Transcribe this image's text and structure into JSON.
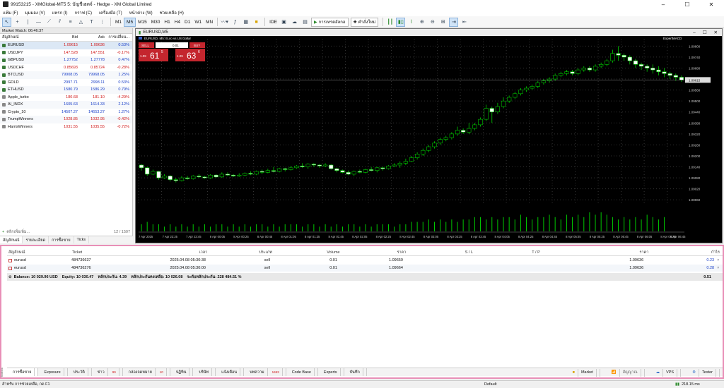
{
  "window": {
    "title": "99153215 - XMGlobal-MT5 5: บัญชีเฮดจ์ - Hedge - XM Global Limited"
  },
  "menu": [
    "แฟ้ม (F)",
    "มุมมอง (V)",
    "แทรก (I)",
    "กราฟ (C)",
    "เครื่องมือ (T)",
    "หน้าต่าง (W)",
    "ช่วยเหลือ (H)"
  ],
  "toolbar": {
    "timeframes": [
      "M1",
      "M5",
      "M15",
      "M30",
      "H1",
      "H4",
      "D1",
      "W1",
      "MN"
    ],
    "active_timeframe": "M5",
    "ide_label": "IDE",
    "algo_label": "การเทรดอัลกอ",
    "new_order_label": "คำสั่งใหม่"
  },
  "market_watch": {
    "header": "Market Watch: 06:46:37",
    "columns": {
      "symbol": "สัญลักษณ์",
      "bid": "Bid",
      "ask": "Ask",
      "change": "การเปลี่ยน..."
    },
    "rows": [
      {
        "symbol": "EURUSD",
        "bid": "1.09615",
        "ask": "1.09636",
        "change": "0.53%",
        "bid_color": "red",
        "ask_color": "red",
        "chg_color": "blue"
      },
      {
        "symbol": "USDJPY",
        "bid": "147.528",
        "ask": "147.551",
        "change": "-0.17%",
        "bid_color": "red",
        "ask_color": "red",
        "chg_color": "red"
      },
      {
        "symbol": "GBPUSD",
        "bid": "1.27752",
        "ask": "1.27778",
        "change": "0.47%",
        "bid_color": "blue",
        "ask_color": "blue",
        "chg_color": "blue"
      },
      {
        "symbol": "USDCHF",
        "bid": "0.85693",
        "ask": "0.85724",
        "change": "-0.28%",
        "bid_color": "red",
        "ask_color": "red",
        "chg_color": "red"
      },
      {
        "symbol": "BTCUSD",
        "bid": "79908.05",
        "ask": "79968.05",
        "change": "1.25%",
        "bid_color": "blue",
        "ask_color": "blue",
        "chg_color": "blue"
      },
      {
        "symbol": "GOLD",
        "bid": "2997.71",
        "ask": "2998.11",
        "change": "0.53%",
        "bid_color": "blue",
        "ask_color": "blue",
        "chg_color": "blue"
      },
      {
        "symbol": "ETHUSD",
        "bid": "1580.79",
        "ask": "1586.29",
        "change": "0.79%",
        "bid_color": "blue",
        "ask_color": "blue",
        "chg_color": "blue"
      },
      {
        "symbol": "Apple_turbo",
        "bid": "180.68",
        "ask": "181.10",
        "change": "-4.29%",
        "bid_color": "red",
        "ask_color": "red",
        "chg_color": "red"
      },
      {
        "symbol": "AI_INDX",
        "bid": "1605.63",
        "ask": "1614.33",
        "change": "2.12%",
        "bid_color": "blue",
        "ask_color": "blue",
        "chg_color": "blue"
      },
      {
        "symbol": "Crypto_10",
        "bid": "14507.27",
        "ask": "14653.27",
        "change": "1.27%",
        "bid_color": "blue",
        "ask_color": "blue",
        "chg_color": "blue"
      },
      {
        "symbol": "TrumpWinners",
        "bid": "1028.85",
        "ask": "1032.95",
        "change": "-0.42%",
        "bid_color": "red",
        "ask_color": "red",
        "chg_color": "red"
      },
      {
        "symbol": "HarrisWinners",
        "bid": "1031.55",
        "ask": "1035.55",
        "change": "-0.72%",
        "bid_color": "red",
        "ask_color": "red",
        "chg_color": "red"
      }
    ],
    "add_symbol": "คลิกเพื่อเพิ่ม...",
    "count": "12 / 1507",
    "tabs": [
      "สัญลักษณ์",
      "รายละเอียด",
      "การซื้อขาย",
      "Ticks"
    ]
  },
  "chart": {
    "window_title": "EURUSD,M5",
    "overlay_title": "EURUSD, M5: Euro vs US Dollar",
    "expert": "ExpertMACD",
    "sell_label": "SELL",
    "buy_label": "BUY",
    "lot": "0.01",
    "sell_price_prefix": "1.09",
    "sell_price_big": "61",
    "sell_price_sup": "5",
    "buy_price_prefix": "1.09",
    "buy_price_big": "63",
    "buy_price_sup": "6",
    "price_tag": "1.09615",
    "y_ticks": [
      "1.09800",
      "1.09740",
      "1.09680",
      "1.09620",
      "1.09560",
      "1.09500",
      "1.09440",
      "1.09380",
      "1.09320",
      "1.09260",
      "1.09200",
      "1.09140",
      "1.09080",
      "1.09020",
      "1.08960"
    ],
    "x_ticks": [
      "7 Apr 2025",
      "7 Apr 23:25",
      "7 Apr 23:45",
      "8 Apr 00:05",
      "8 Apr 00:25",
      "8 Apr 00:45",
      "8 Apr 01:05",
      "8 Apr 01:25",
      "8 Apr 01:45",
      "8 Apr 02:05",
      "8 Apr 02:25",
      "8 Apr 02:45",
      "8 Apr 03:05",
      "8 Apr 03:25",
      "8 Apr 03:45",
      "8 Apr 04:05",
      "8 Apr 04:25",
      "8 Apr 04:45",
      "8 Apr 05:05",
      "8 Apr 05:25",
      "8 Apr 05:45",
      "8 Apr 06:05",
      "8 Apr 06:25",
      "8 Apr 06:45"
    ],
    "colors": {
      "bg": "#000000",
      "up": "#00c800",
      "down": "#ffffff",
      "grid": "#1e1e1e"
    }
  },
  "chart_data": {
    "type": "candlestick",
    "symbol": "EURUSD",
    "timeframe": "M5",
    "ylim": [
      1.0893,
      1.0984
    ],
    "candles": [
      [
        1.0915,
        1.09135,
        1.0912,
        1.09155
      ],
      [
        1.09135,
        1.091,
        1.0909,
        1.0914
      ],
      [
        1.091,
        1.09115,
        1.09095,
        1.09125
      ],
      [
        1.09115,
        1.0908,
        1.0907,
        1.09118
      ],
      [
        1.0908,
        1.0909,
        1.09075,
        1.091
      ],
      [
        1.0909,
        1.0907,
        1.0906,
        1.09095
      ],
      [
        1.0907,
        1.09065,
        1.09055,
        1.0908
      ],
      [
        1.09065,
        1.0908,
        1.0906,
        1.0909
      ],
      [
        1.0908,
        1.09075,
        1.0907,
        1.0909
      ],
      [
        1.09075,
        1.0909,
        1.0907,
        1.09095
      ],
      [
        1.0909,
        1.09085,
        1.0908,
        1.091
      ],
      [
        1.09085,
        1.0908,
        1.09075,
        1.0909
      ],
      [
        1.0908,
        1.09095,
        1.09075,
        1.091
      ],
      [
        1.09095,
        1.09085,
        1.0908,
        1.091
      ],
      [
        1.09085,
        1.091,
        1.0908,
        1.0911
      ],
      [
        1.091,
        1.09095,
        1.0909,
        1.0911
      ],
      [
        1.09095,
        1.0909,
        1.09085,
        1.091
      ],
      [
        1.0909,
        1.09095,
        1.09085,
        1.09105
      ],
      [
        1.09095,
        1.09105,
        1.0909,
        1.0911
      ],
      [
        1.09105,
        1.091,
        1.09095,
        1.09115
      ],
      [
        1.091,
        1.09115,
        1.09095,
        1.0912
      ],
      [
        1.09115,
        1.0911,
        1.091,
        1.09125
      ],
      [
        1.0911,
        1.0912,
        1.09105,
        1.0913
      ],
      [
        1.0912,
        1.09115,
        1.0911,
        1.0914
      ],
      [
        1.09115,
        1.0913,
        1.0911,
        1.09135
      ],
      [
        1.0913,
        1.09125,
        1.09115,
        1.09135
      ],
      [
        1.09125,
        1.09135,
        1.0912,
        1.09145
      ],
      [
        1.09135,
        1.09145,
        1.0913,
        1.0915
      ],
      [
        1.09145,
        1.0914,
        1.09135,
        1.0916
      ],
      [
        1.0914,
        1.09155,
        1.0913,
        1.0916
      ],
      [
        1.09155,
        1.0915,
        1.0914,
        1.0916
      ],
      [
        1.0915,
        1.09145,
        1.09135,
        1.09155
      ],
      [
        1.09145,
        1.0915,
        1.0914,
        1.0916
      ],
      [
        1.0915,
        1.0913,
        1.09125,
        1.09155
      ],
      [
        1.0913,
        1.0912,
        1.0911,
        1.09135
      ],
      [
        1.0912,
        1.0911,
        1.09105,
        1.09125
      ],
      [
        1.0911,
        1.091,
        1.09095,
        1.0912
      ],
      [
        1.091,
        1.09115,
        1.0909,
        1.0912
      ],
      [
        1.09115,
        1.0911,
        1.09105,
        1.09125
      ],
      [
        1.0911,
        1.09125,
        1.09105,
        1.0913
      ],
      [
        1.09125,
        1.0912,
        1.09115,
        1.0914
      ],
      [
        1.0912,
        1.09135,
        1.0911,
        1.0914
      ],
      [
        1.09135,
        1.0913,
        1.0912,
        1.0914
      ],
      [
        1.0913,
        1.09145,
        1.09125,
        1.0915
      ],
      [
        1.09145,
        1.0915,
        1.0914,
        1.0916
      ],
      [
        1.0915,
        1.0916,
        1.09135,
        1.0917
      ],
      [
        1.0916,
        1.0917,
        1.0915,
        1.09185
      ],
      [
        1.0917,
        1.0919,
        1.09165,
        1.092
      ],
      [
        1.0919,
        1.0921,
        1.0918,
        1.0922
      ],
      [
        1.0921,
        1.0923,
        1.092,
        1.0924
      ],
      [
        1.0923,
        1.0925,
        1.0922,
        1.0926
      ],
      [
        1.0925,
        1.0927,
        1.0924,
        1.0928
      ],
      [
        1.0927,
        1.0929,
        1.0926,
        1.093
      ],
      [
        1.0929,
        1.093,
        1.0928,
        1.0931
      ],
      [
        1.093,
        1.0932,
        1.0929,
        1.0933
      ],
      [
        1.0932,
        1.0934,
        1.0931,
        1.0936
      ],
      [
        1.0934,
        1.0933,
        1.0932,
        1.0935
      ],
      [
        1.0933,
        1.0935,
        1.0932,
        1.0938
      ],
      [
        1.0935,
        1.0937,
        1.0934,
        1.0938
      ],
      [
        1.0937,
        1.094,
        1.0936,
        1.0941
      ],
      [
        1.094,
        1.0946,
        1.0939,
        1.0948
      ],
      [
        1.0946,
        1.0944,
        1.0938,
        1.0947
      ],
      [
        1.0944,
        1.0947,
        1.0943,
        1.0949
      ],
      [
        1.0947,
        1.095,
        1.0946,
        1.0952
      ],
      [
        1.095,
        1.0952,
        1.0949,
        1.0953
      ],
      [
        1.0952,
        1.0954,
        1.0951,
        1.0955
      ],
      [
        1.0954,
        1.0956,
        1.0953,
        1.0957
      ],
      [
        1.0956,
        1.0957,
        1.0955,
        1.0958
      ],
      [
        1.0957,
        1.0958,
        1.0956,
        1.0959
      ],
      [
        1.0958,
        1.096,
        1.0957,
        1.0961
      ],
      [
        1.096,
        1.0961,
        1.0959,
        1.0962
      ],
      [
        1.0961,
        1.0962,
        1.096,
        1.0963
      ],
      [
        1.0962,
        1.0964,
        1.0961,
        1.0965
      ],
      [
        1.0964,
        1.0965,
        1.0963,
        1.0966
      ],
      [
        1.0965,
        1.0966,
        1.0964,
        1.0967
      ],
      [
        1.0966,
        1.0965,
        1.0964,
        1.0967
      ],
      [
        1.0965,
        1.0967,
        1.0964,
        1.0968
      ],
      [
        1.0967,
        1.0968,
        1.0966,
        1.0969
      ],
      [
        1.0968,
        1.0967,
        1.0966,
        1.0969
      ],
      [
        1.0967,
        1.0969,
        1.0966,
        1.097
      ],
      [
        1.0969,
        1.097,
        1.0968,
        1.0971
      ],
      [
        1.097,
        1.0972,
        1.0969,
        1.0973
      ],
      [
        1.0972,
        1.0976,
        1.0971,
        1.0978
      ],
      [
        1.0976,
        1.0975,
        1.0972,
        1.098
      ],
      [
        1.0975,
        1.0974,
        1.0972,
        1.0976
      ],
      [
        1.0974,
        1.0972,
        1.097,
        1.0975
      ],
      [
        1.0972,
        1.097,
        1.0968,
        1.0973
      ],
      [
        1.097,
        1.0969,
        1.0967,
        1.0971
      ],
      [
        1.0969,
        1.0968,
        1.0966,
        1.097
      ],
      [
        1.0968,
        1.0967,
        1.0965,
        1.097
      ],
      [
        1.0967,
        1.0966,
        1.0964,
        1.0969
      ],
      [
        1.0966,
        1.0965,
        1.0963,
        1.0968
      ],
      [
        1.0965,
        1.0964,
        1.0962,
        1.0966
      ],
      [
        1.0964,
        1.0963,
        1.0961,
        1.0965
      ],
      [
        1.0963,
        1.09615,
        1.09605,
        1.0964
      ]
    ],
    "volume": [
      3,
      4,
      3,
      3,
      2,
      3,
      2,
      3,
      2,
      3,
      2,
      3,
      2,
      3,
      3,
      2,
      3,
      2,
      3,
      2,
      3,
      3,
      2,
      3,
      2,
      3,
      3,
      3,
      2,
      3,
      3,
      2,
      3,
      2,
      3,
      2,
      3,
      3,
      2,
      3,
      2,
      3,
      3,
      3,
      2,
      3,
      3,
      4,
      4,
      4,
      5,
      4,
      5,
      4,
      5,
      4,
      5,
      5,
      6,
      6,
      5,
      6,
      5,
      6,
      6,
      5,
      7,
      6,
      5,
      6,
      6,
      7,
      6,
      5,
      7,
      6,
      7,
      6,
      8,
      7,
      8,
      7,
      6,
      5,
      6,
      5,
      6,
      5,
      7,
      6,
      5,
      6
    ],
    "last_price": "1.09615"
  },
  "positions": {
    "columns": {
      "symbol": "สัญลักษณ์",
      "ticket": "Ticket",
      "time": "เวลา",
      "type": "ประเภท",
      "volume": "Volume",
      "price": "ราคา",
      "sl": "S / L",
      "tp": "T / P",
      "current": "ราคา",
      "profit": "กำไร"
    },
    "rows": [
      {
        "symbol": "eurusd",
        "ticket": "484736637",
        "time": "2025.04.08 05:30:38",
        "type": "sell",
        "volume": "0.01",
        "price": "1.09659",
        "sl": "",
        "tp": "",
        "current": "1.09636",
        "profit": "0.23"
      },
      {
        "symbol": "eurusd",
        "ticket": "484736276",
        "time": "2025.04.08 05:30:00",
        "type": "sell",
        "volume": "0.01",
        "price": "1.09664",
        "sl": "",
        "tp": "",
        "current": "1.09636",
        "profit": "0.28"
      }
    ],
    "balance": {
      "balance": "Balance: 10 029.96 USD",
      "equity": "Equity: 10 030.47",
      "margin": "หลักประกัน: 4.39",
      "free_margin": "หลักประกันคงเหลือ: 10 026.08",
      "margin_level": "ระดับหลักประกัน: 228 484.51 %",
      "total": "0.51"
    }
  },
  "bottom_tabs": [
    {
      "label": "การซื้อขาย",
      "badge": ""
    },
    {
      "label": "Exposure",
      "badge": ""
    },
    {
      "label": "ประวัติ",
      "badge": ""
    },
    {
      "label": "ข่าว",
      "badge": "99"
    },
    {
      "label": "กล่องจดหมาย",
      "badge": "10"
    },
    {
      "label": "ปฏิทิน",
      "badge": ""
    },
    {
      "label": "บริษัท",
      "badge": ""
    },
    {
      "label": "แจ้งเตือน",
      "badge": ""
    },
    {
      "label": "บทความ",
      "badge": "1693"
    },
    {
      "label": "Code Base",
      "badge": ""
    },
    {
      "label": "Experts",
      "badge": ""
    },
    {
      "label": "บันทึก",
      "badge": ""
    }
  ],
  "bottom_right": {
    "market": "Market",
    "signals": "สัญญาณ",
    "vps": "VPS",
    "tester": "Tester"
  },
  "toolbox_label": "Toolbox",
  "status": {
    "help": "สำหรับ การช่วยเหลือ, กด F1",
    "profile": "Default",
    "ping": "218.15 ms"
  }
}
